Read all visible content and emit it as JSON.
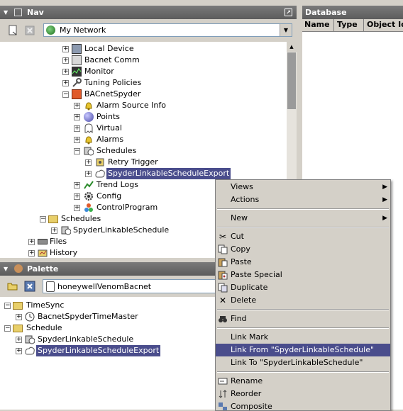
{
  "nav": {
    "title": "Nav",
    "network_select": "My Network",
    "tree": [
      {
        "label": "Local Device"
      },
      {
        "label": "Bacnet Comm"
      },
      {
        "label": "Monitor"
      },
      {
        "label": "Tuning Policies"
      },
      {
        "label": "BACnetSpyder"
      },
      {
        "label": "Alarm Source Info"
      },
      {
        "label": "Points"
      },
      {
        "label": "Virtual"
      },
      {
        "label": "Alarms"
      },
      {
        "label": "Schedules"
      },
      {
        "label": "Retry Trigger"
      },
      {
        "label": "SpyderLinkableScheduleExport"
      },
      {
        "label": "Trend Logs"
      },
      {
        "label": "Config"
      },
      {
        "label": "ControlProgram"
      },
      {
        "label": "Schedules"
      },
      {
        "label": "SpyderLinkableSchedule"
      },
      {
        "label": "Files"
      },
      {
        "label": "History"
      }
    ]
  },
  "database": {
    "title": "Database",
    "columns": [
      "Name",
      "Type",
      "Object Id"
    ]
  },
  "palette": {
    "title": "Palette",
    "module": "honeywellVenomBacnet",
    "tree": [
      {
        "label": "TimeSync"
      },
      {
        "label": "BacnetSpyderTimeMaster"
      },
      {
        "label": "Schedule"
      },
      {
        "label": "SpyderLinkableSchedule"
      },
      {
        "label": "SpyderLinkableScheduleExport"
      }
    ]
  },
  "context_menu": {
    "items": [
      {
        "label": "Views",
        "icon": "none"
      },
      {
        "label": "Actions",
        "icon": "none"
      },
      {
        "label": "New",
        "icon": "none"
      },
      {
        "label": "Cut",
        "icon": "scissors-icon"
      },
      {
        "label": "Copy",
        "icon": "copy-icon"
      },
      {
        "label": "Paste",
        "icon": "paste-icon"
      },
      {
        "label": "Paste Special",
        "icon": "paste-special-icon"
      },
      {
        "label": "Duplicate",
        "icon": "duplicate-icon"
      },
      {
        "label": "Delete",
        "icon": "delete-icon"
      },
      {
        "label": "Find",
        "icon": "binoculars-icon"
      },
      {
        "label": "Link Mark",
        "icon": "none"
      },
      {
        "label": "Link From \"SpyderLinkableSchedule\"",
        "icon": "none",
        "highlighted": true
      },
      {
        "label": "Link To \"SpyderLinkableSchedule\"",
        "icon": "none"
      },
      {
        "label": "Rename",
        "icon": "rename-icon"
      },
      {
        "label": "Reorder",
        "icon": "reorder-icon"
      },
      {
        "label": "Composite",
        "icon": "composite-icon"
      }
    ]
  },
  "colors": {
    "selection": "#4a4d8c",
    "titlebar": "#666666",
    "panel": "#d4d0c8"
  }
}
